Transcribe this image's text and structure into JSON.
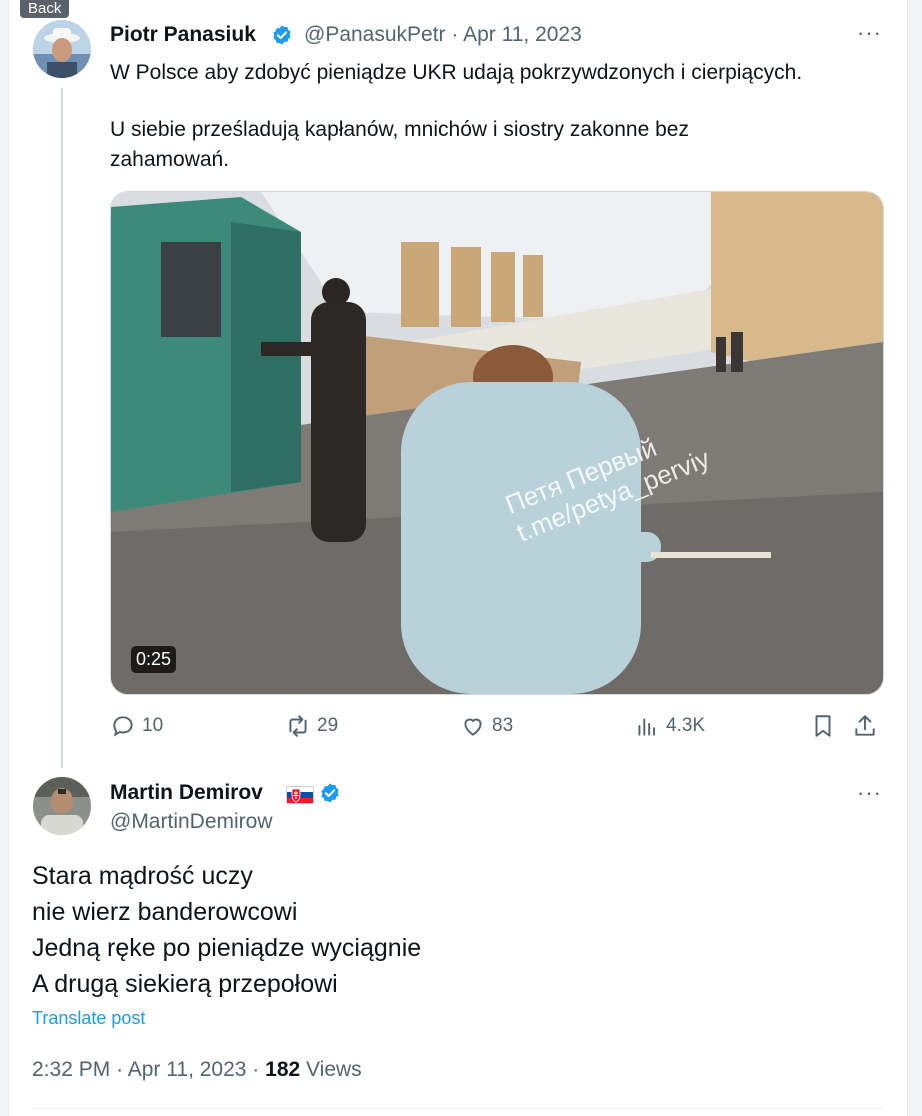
{
  "nav": {
    "back_label": "Back"
  },
  "tweet": {
    "author_name": "Piotr Panasiuk",
    "handle": "@PanasukPetr",
    "separator": "·",
    "date": "Apr 11, 2023",
    "line1": "W Polsce aby zdobyć pieniądze UKR udają pokrzywdzonych i cierpiących.",
    "line2": "U siebie prześladują kapłanów, mnichów i siostry zakonne bez",
    "line3": "zahamowań.",
    "video": {
      "duration": "0:25",
      "watermark_line1": "Петя Первый",
      "watermark_line2": "t.me/petya_perviy"
    },
    "stats": {
      "replies": "10",
      "reposts": "29",
      "likes": "83",
      "views": "4.3K"
    },
    "colors": {
      "verified": "#1d9bf0",
      "secondary_text": "#536471"
    }
  },
  "reply": {
    "author_name": "Martin Demirov",
    "flag": "slovakia-flag",
    "handle": "@MartinDemirow",
    "lines": [
      "Stara mądrość uczy",
      "nie wierz banderowcowi",
      "Jedną ręke po pieniądze wyciągnie",
      "A drugą siekierą przepołowi"
    ],
    "translate_label": "Translate post",
    "time": "2:32 PM",
    "dot": "·",
    "date": "Apr 11, 2023",
    "views_count": "182",
    "views_label": "Views"
  }
}
